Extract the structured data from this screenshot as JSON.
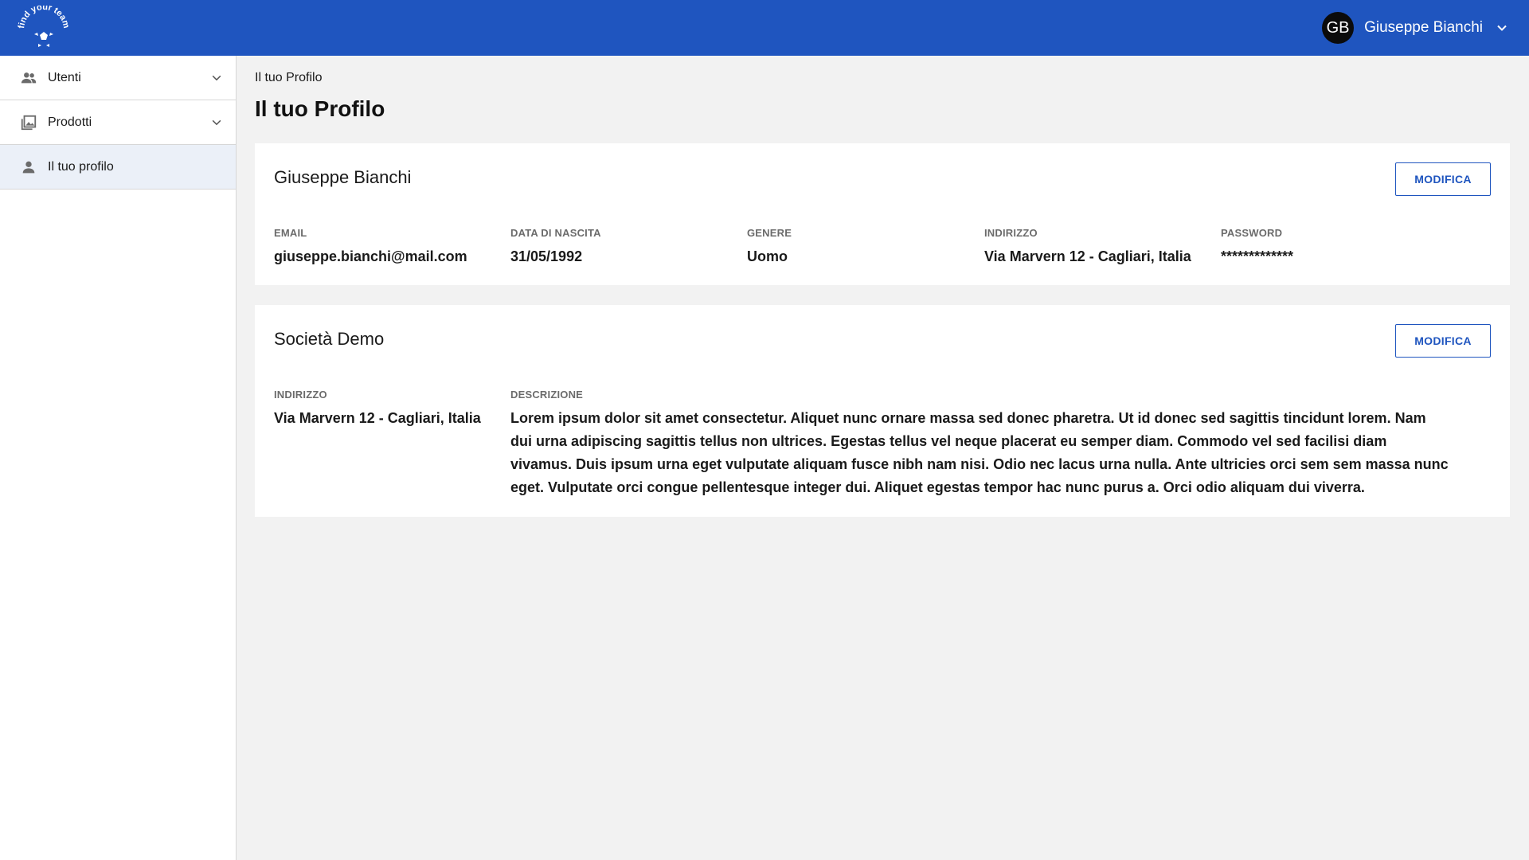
{
  "header": {
    "logo_text": "find your team",
    "user": {
      "initials": "GB",
      "name": "Giuseppe Bianchi"
    }
  },
  "sidebar": {
    "items": [
      {
        "label": "Utenti",
        "icon": "users-icon",
        "expandable": true
      },
      {
        "label": "Prodotti",
        "icon": "gallery-icon",
        "expandable": true
      },
      {
        "label": "Il tuo profilo",
        "icon": "person-icon",
        "expandable": false,
        "active": true
      }
    ]
  },
  "main": {
    "breadcrumb": "Il tuo Profilo",
    "title": "Il tuo Profilo",
    "profile_card": {
      "title": "Giuseppe Bianchi",
      "edit_label": "MODIFICA",
      "fields": [
        {
          "label": "EMAIL",
          "value": "giuseppe.bianchi@mail.com"
        },
        {
          "label": "DATA DI NASCITA",
          "value": "31/05/1992"
        },
        {
          "label": "GENERE",
          "value": "Uomo"
        },
        {
          "label": "INDIRIZZO",
          "value": "Via Marvern 12 - Cagliari, Italia"
        },
        {
          "label": "PASSWORD",
          "value": "*************"
        }
      ]
    },
    "company_card": {
      "title": "Società Demo",
      "edit_label": "MODIFICA",
      "fields": [
        {
          "label": "INDIRIZZO",
          "value": "Via Marvern 12 - Cagliari, Italia"
        },
        {
          "label": "DESCRIZIONE",
          "value": "Lorem ipsum dolor sit amet consectetur. Aliquet nunc ornare massa sed donec pharetra. Ut id donec sed sagittis tincidunt lorem. Nam dui urna adipiscing sagittis tellus non ultrices. Egestas tellus vel neque placerat eu semper diam. Commodo vel sed facilisi diam vivamus. Duis ipsum urna eget vulputate aliquam fusce nibh nam nisi. Odio nec lacus urna nulla. Ante ultricies orci sem sem massa nunc eget. Vulputate orci congue pellentesque integer dui. Aliquet egestas tempor hac nunc purus a. Orci odio aliquam dui viverra."
        }
      ]
    }
  },
  "colors": {
    "primary": "#1f55bf",
    "background": "#f2f2f2",
    "active_nav": "#ebf0f8"
  }
}
